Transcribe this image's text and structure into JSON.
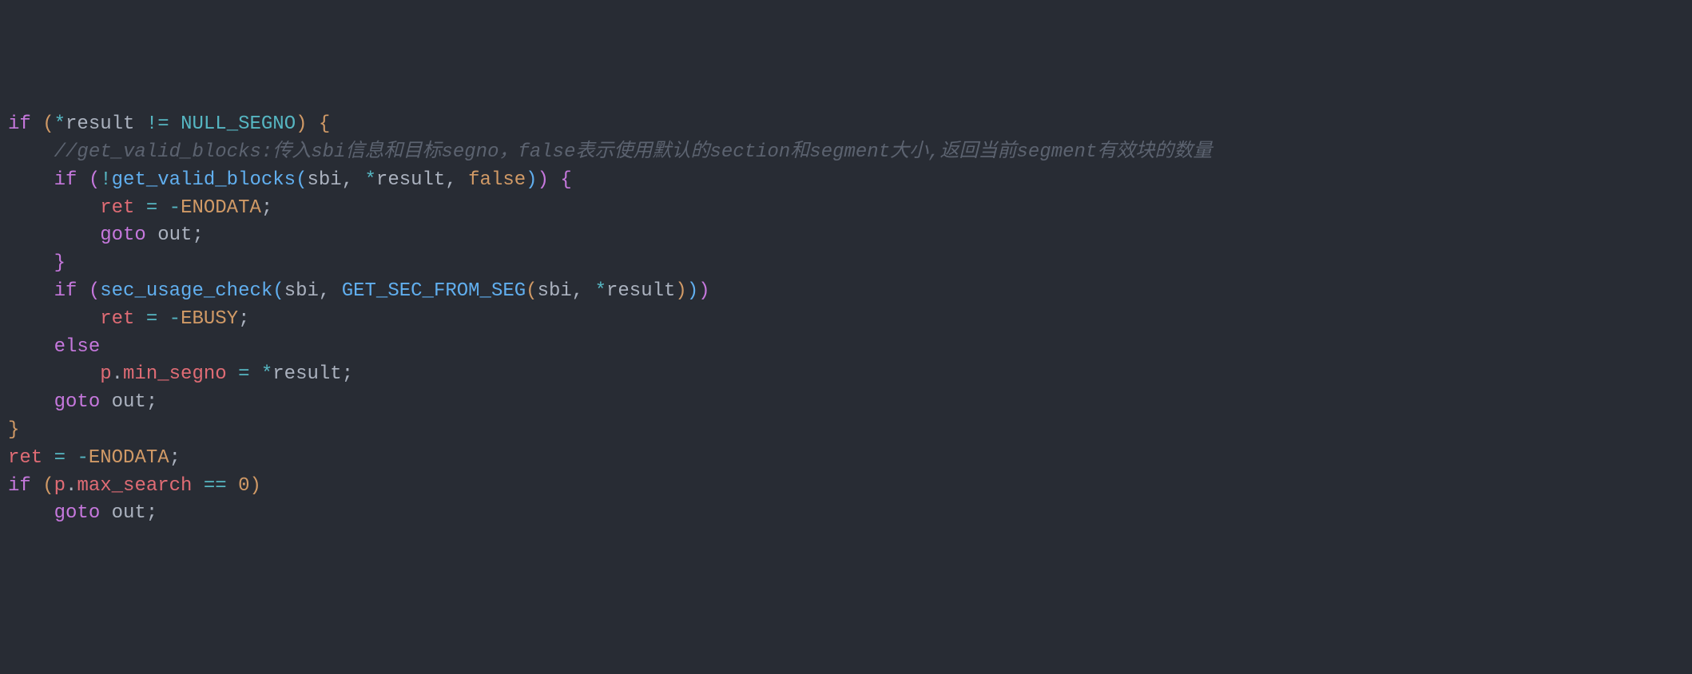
{
  "code": {
    "lines": [
      {
        "indent": 0,
        "tokens": [
          {
            "t": "if",
            "c": "kw"
          },
          {
            "t": " ",
            "c": ""
          },
          {
            "t": "(",
            "c": "brace-y"
          },
          {
            "t": "*",
            "c": "op"
          },
          {
            "t": "result",
            "c": "param"
          },
          {
            "t": " ",
            "c": ""
          },
          {
            "t": "!=",
            "c": "op"
          },
          {
            "t": " ",
            "c": ""
          },
          {
            "t": "NULL_SEGNO",
            "c": "macro"
          },
          {
            "t": ")",
            "c": "brace-y"
          },
          {
            "t": " ",
            "c": ""
          },
          {
            "t": "{",
            "c": "brace-y"
          }
        ]
      },
      {
        "indent": 1,
        "tokens": [
          {
            "t": "//get_valid_blocks:传入sbi信息和目标segno，false表示使用默认的section和segment大小,返回当前segment有效块的数量",
            "c": "comment"
          }
        ]
      },
      {
        "indent": 1,
        "tokens": [
          {
            "t": "if",
            "c": "kw"
          },
          {
            "t": " ",
            "c": ""
          },
          {
            "t": "(",
            "c": "brace-p"
          },
          {
            "t": "!",
            "c": "op"
          },
          {
            "t": "get_valid_blocks",
            "c": "fn"
          },
          {
            "t": "(",
            "c": "brace-b"
          },
          {
            "t": "sbi",
            "c": "param"
          },
          {
            "t": ",",
            "c": "punct"
          },
          {
            "t": " ",
            "c": ""
          },
          {
            "t": "*",
            "c": "op"
          },
          {
            "t": "result",
            "c": "param"
          },
          {
            "t": ",",
            "c": "punct"
          },
          {
            "t": " ",
            "c": ""
          },
          {
            "t": "false",
            "c": "const"
          },
          {
            "t": ")",
            "c": "brace-b"
          },
          {
            "t": ")",
            "c": "brace-p"
          },
          {
            "t": " ",
            "c": ""
          },
          {
            "t": "{",
            "c": "brace-p"
          }
        ]
      },
      {
        "indent": 2,
        "tokens": [
          {
            "t": "ret",
            "c": "var"
          },
          {
            "t": " ",
            "c": ""
          },
          {
            "t": "=",
            "c": "op"
          },
          {
            "t": " ",
            "c": ""
          },
          {
            "t": "-",
            "c": "op"
          },
          {
            "t": "ENODATA",
            "c": "const"
          },
          {
            "t": ";",
            "c": "punct"
          }
        ]
      },
      {
        "indent": 2,
        "tokens": [
          {
            "t": "goto",
            "c": "kw"
          },
          {
            "t": " ",
            "c": ""
          },
          {
            "t": "out",
            "c": "param"
          },
          {
            "t": ";",
            "c": "punct"
          }
        ]
      },
      {
        "indent": 1,
        "tokens": [
          {
            "t": "}",
            "c": "brace-p"
          }
        ]
      },
      {
        "indent": 0,
        "highlighted": true,
        "tokens": [
          {
            "t": "",
            "c": ""
          }
        ]
      },
      {
        "indent": 1,
        "tokens": [
          {
            "t": "if",
            "c": "kw"
          },
          {
            "t": " ",
            "c": ""
          },
          {
            "t": "(",
            "c": "brace-p"
          },
          {
            "t": "sec_usage_check",
            "c": "fn"
          },
          {
            "t": "(",
            "c": "brace-b"
          },
          {
            "t": "sbi",
            "c": "param"
          },
          {
            "t": ",",
            "c": "punct"
          },
          {
            "t": " ",
            "c": ""
          },
          {
            "t": "GET_SEC_FROM_SEG",
            "c": "fn"
          },
          {
            "t": "(",
            "c": "brace-y"
          },
          {
            "t": "sbi",
            "c": "param"
          },
          {
            "t": ",",
            "c": "punct"
          },
          {
            "t": " ",
            "c": ""
          },
          {
            "t": "*",
            "c": "op"
          },
          {
            "t": "result",
            "c": "param"
          },
          {
            "t": ")",
            "c": "brace-y"
          },
          {
            "t": ")",
            "c": "brace-b"
          },
          {
            "t": ")",
            "c": "brace-p"
          }
        ]
      },
      {
        "indent": 2,
        "tokens": [
          {
            "t": "ret",
            "c": "var"
          },
          {
            "t": " ",
            "c": ""
          },
          {
            "t": "=",
            "c": "op"
          },
          {
            "t": " ",
            "c": ""
          },
          {
            "t": "-",
            "c": "op"
          },
          {
            "t": "EBUSY",
            "c": "const"
          },
          {
            "t": ";",
            "c": "punct"
          }
        ]
      },
      {
        "indent": 1,
        "tokens": [
          {
            "t": "else",
            "c": "kw"
          }
        ]
      },
      {
        "indent": 2,
        "tokens": [
          {
            "t": "p",
            "c": "var"
          },
          {
            "t": ".",
            "c": "punct"
          },
          {
            "t": "min_segno",
            "c": "member"
          },
          {
            "t": " ",
            "c": ""
          },
          {
            "t": "=",
            "c": "op"
          },
          {
            "t": " ",
            "c": ""
          },
          {
            "t": "*",
            "c": "op"
          },
          {
            "t": "result",
            "c": "param"
          },
          {
            "t": ";",
            "c": "punct"
          }
        ]
      },
      {
        "indent": 1,
        "tokens": [
          {
            "t": "goto",
            "c": "kw"
          },
          {
            "t": " ",
            "c": ""
          },
          {
            "t": "out",
            "c": "param"
          },
          {
            "t": ";",
            "c": "punct"
          }
        ]
      },
      {
        "indent": 0,
        "tokens": [
          {
            "t": "}",
            "c": "brace-y"
          }
        ]
      },
      {
        "indent": 0,
        "tokens": [
          {
            "t": "",
            "c": ""
          }
        ]
      },
      {
        "indent": 0,
        "tokens": [
          {
            "t": "ret",
            "c": "var"
          },
          {
            "t": " ",
            "c": ""
          },
          {
            "t": "=",
            "c": "op"
          },
          {
            "t": " ",
            "c": ""
          },
          {
            "t": "-",
            "c": "op"
          },
          {
            "t": "ENODATA",
            "c": "const"
          },
          {
            "t": ";",
            "c": "punct"
          }
        ]
      },
      {
        "indent": 0,
        "tokens": [
          {
            "t": "if",
            "c": "kw"
          },
          {
            "t": " ",
            "c": ""
          },
          {
            "t": "(",
            "c": "brace-y"
          },
          {
            "t": "p",
            "c": "var"
          },
          {
            "t": ".",
            "c": "punct"
          },
          {
            "t": "max_search",
            "c": "member"
          },
          {
            "t": " ",
            "c": ""
          },
          {
            "t": "==",
            "c": "op"
          },
          {
            "t": " ",
            "c": ""
          },
          {
            "t": "0",
            "c": "const"
          },
          {
            "t": ")",
            "c": "brace-y"
          }
        ]
      },
      {
        "indent": 1,
        "tokens": [
          {
            "t": "goto",
            "c": "kw"
          },
          {
            "t": " ",
            "c": ""
          },
          {
            "t": "out",
            "c": "param"
          },
          {
            "t": ";",
            "c": "punct"
          }
        ]
      }
    ]
  }
}
